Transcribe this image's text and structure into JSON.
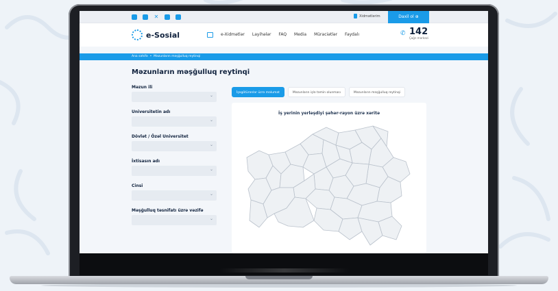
{
  "topbar": {
    "social_icons": [
      "facebook-icon",
      "instagram-icon",
      "x-icon",
      "youtube-icon",
      "linkedin-icon"
    ],
    "services_label": "Xidmətlərim",
    "login_label": "Daxil ol"
  },
  "header": {
    "logo_text": "e-Sosial",
    "nav": [
      "e-Xidmətlər",
      "Layihələr",
      "FAQ",
      "Media",
      "Müraciətlər",
      "Faydalı"
    ],
    "hotline_number": "142",
    "hotline_caption": "Çağrı mərkəzi"
  },
  "breadcrumb": {
    "home": "Ana səhifə",
    "separator": "•",
    "current": "Məzunların məşğulluq reytinqi"
  },
  "page": {
    "title": "Məzunların məşğulluq reytinqi"
  },
  "filters": [
    {
      "label": "Məzun ili",
      "value": ""
    },
    {
      "label": "Universitetin adı",
      "value": ""
    },
    {
      "label": "Dövlət / Özəl Universitet",
      "value": ""
    },
    {
      "label": "İxtisasın adı",
      "value": ""
    },
    {
      "label": "Cinsi",
      "value": ""
    },
    {
      "label": "Məşğulluq təsnifatı üzrə vəzifə",
      "value": ""
    }
  ],
  "tabs": [
    {
      "label": "İşəgötürənlər üzrə məlumat",
      "active": true
    },
    {
      "label": "Məzunların işlə təmin olunması",
      "active": false
    },
    {
      "label": "Məzunların məşğulluq reytinqi",
      "active": false
    }
  ],
  "map": {
    "title": "İş yerinin yerləşdiyi şəhər-rayon üzrə xəritə"
  },
  "colors": {
    "accent": "#1a9be8",
    "dark_text": "#10223d",
    "region_fill": "#eef1f4",
    "region_stroke": "#b9c1cb"
  }
}
